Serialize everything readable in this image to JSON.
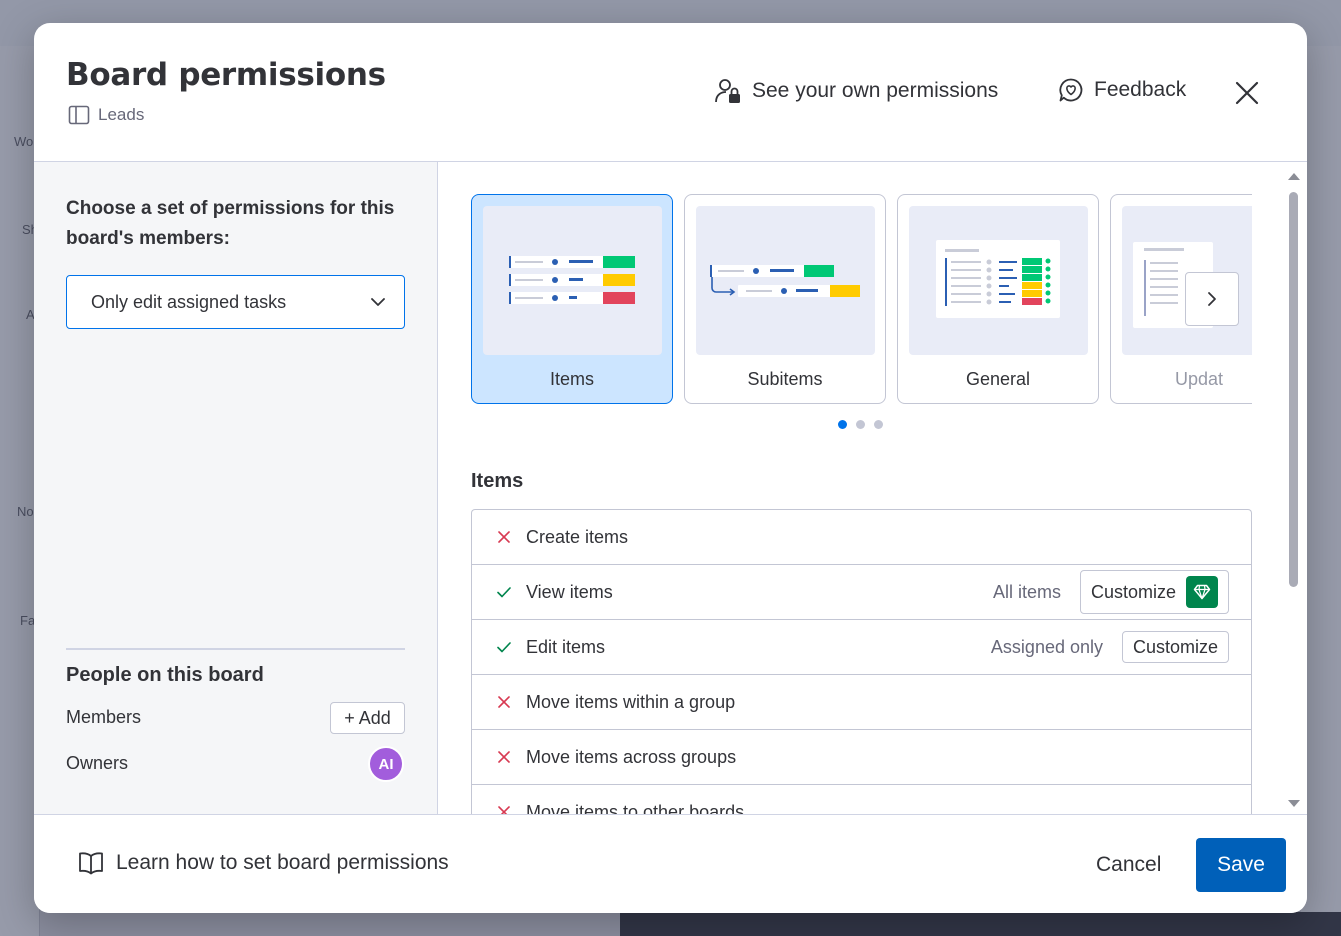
{
  "background": {
    "fragments": [
      "Wo",
      "Sh",
      "A",
      "No",
      "Fa"
    ]
  },
  "modal": {
    "title": "Board permissions",
    "board_name": "Leads",
    "own_permissions_label": "See your own permissions",
    "feedback_label": "Feedback",
    "icons": {
      "board": "board-icon",
      "own_permissions": "person-lock-icon",
      "feedback": "feedback-icon",
      "close": "close-icon"
    }
  },
  "left": {
    "choose_label": "Choose a set of permissions for this board's members:",
    "selected_option": "Only edit assigned tasks",
    "people_title": "People on this board",
    "members_label": "Members",
    "add_label": "+ Add",
    "owners_label": "Owners",
    "owner_avatar_initials": "AI",
    "avatar_color": "#a25ddc"
  },
  "carousel": {
    "cards": [
      {
        "label": "Items",
        "selected": true
      },
      {
        "label": "Subitems",
        "selected": false
      },
      {
        "label": "General",
        "selected": false
      },
      {
        "label": "Updat",
        "selected": false
      }
    ],
    "page_count": 3,
    "active_page": 1
  },
  "items_section": {
    "title": "Items",
    "rows": [
      {
        "label": "Create items",
        "allowed": false
      },
      {
        "label": "View items",
        "allowed": true,
        "value": "All items",
        "customize_label": "Customize",
        "premium": true
      },
      {
        "label": "Edit items",
        "allowed": true,
        "value": "Assigned only",
        "customize_label": "Customize",
        "premium": false
      },
      {
        "label": "Move items within a group",
        "allowed": false
      },
      {
        "label": "Move items across groups",
        "allowed": false
      },
      {
        "label": "Move items to other boards",
        "allowed": false
      }
    ]
  },
  "footer": {
    "learn_label": "Learn how to set board permissions",
    "cancel_label": "Cancel",
    "save_label": "Save"
  },
  "colors": {
    "accent": "#0073ea",
    "save": "#0060b9",
    "deny": "#d83a52",
    "allow": "#00854d",
    "premium": "#00854d"
  }
}
